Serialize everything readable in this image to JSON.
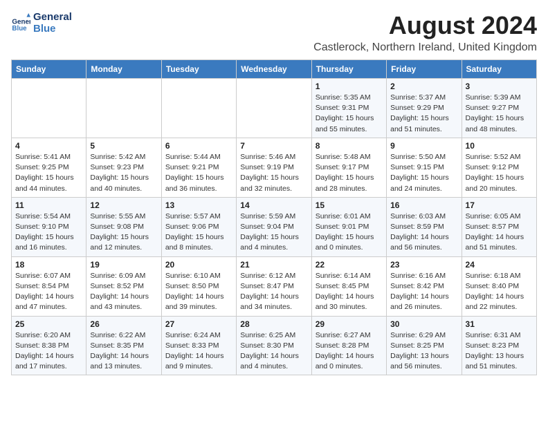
{
  "header": {
    "logo_line1": "General",
    "logo_line2": "Blue",
    "month_year": "August 2024",
    "location": "Castlerock, Northern Ireland, United Kingdom"
  },
  "weekdays": [
    "Sunday",
    "Monday",
    "Tuesday",
    "Wednesday",
    "Thursday",
    "Friday",
    "Saturday"
  ],
  "weeks": [
    [
      {
        "day": "",
        "detail": ""
      },
      {
        "day": "",
        "detail": ""
      },
      {
        "day": "",
        "detail": ""
      },
      {
        "day": "",
        "detail": ""
      },
      {
        "day": "1",
        "detail": "Sunrise: 5:35 AM\nSunset: 9:31 PM\nDaylight: 15 hours\nand 55 minutes."
      },
      {
        "day": "2",
        "detail": "Sunrise: 5:37 AM\nSunset: 9:29 PM\nDaylight: 15 hours\nand 51 minutes."
      },
      {
        "day": "3",
        "detail": "Sunrise: 5:39 AM\nSunset: 9:27 PM\nDaylight: 15 hours\nand 48 minutes."
      }
    ],
    [
      {
        "day": "4",
        "detail": "Sunrise: 5:41 AM\nSunset: 9:25 PM\nDaylight: 15 hours\nand 44 minutes."
      },
      {
        "day": "5",
        "detail": "Sunrise: 5:42 AM\nSunset: 9:23 PM\nDaylight: 15 hours\nand 40 minutes."
      },
      {
        "day": "6",
        "detail": "Sunrise: 5:44 AM\nSunset: 9:21 PM\nDaylight: 15 hours\nand 36 minutes."
      },
      {
        "day": "7",
        "detail": "Sunrise: 5:46 AM\nSunset: 9:19 PM\nDaylight: 15 hours\nand 32 minutes."
      },
      {
        "day": "8",
        "detail": "Sunrise: 5:48 AM\nSunset: 9:17 PM\nDaylight: 15 hours\nand 28 minutes."
      },
      {
        "day": "9",
        "detail": "Sunrise: 5:50 AM\nSunset: 9:15 PM\nDaylight: 15 hours\nand 24 minutes."
      },
      {
        "day": "10",
        "detail": "Sunrise: 5:52 AM\nSunset: 9:12 PM\nDaylight: 15 hours\nand 20 minutes."
      }
    ],
    [
      {
        "day": "11",
        "detail": "Sunrise: 5:54 AM\nSunset: 9:10 PM\nDaylight: 15 hours\nand 16 minutes."
      },
      {
        "day": "12",
        "detail": "Sunrise: 5:55 AM\nSunset: 9:08 PM\nDaylight: 15 hours\nand 12 minutes."
      },
      {
        "day": "13",
        "detail": "Sunrise: 5:57 AM\nSunset: 9:06 PM\nDaylight: 15 hours\nand 8 minutes."
      },
      {
        "day": "14",
        "detail": "Sunrise: 5:59 AM\nSunset: 9:04 PM\nDaylight: 15 hours\nand 4 minutes."
      },
      {
        "day": "15",
        "detail": "Sunrise: 6:01 AM\nSunset: 9:01 PM\nDaylight: 15 hours\nand 0 minutes."
      },
      {
        "day": "16",
        "detail": "Sunrise: 6:03 AM\nSunset: 8:59 PM\nDaylight: 14 hours\nand 56 minutes."
      },
      {
        "day": "17",
        "detail": "Sunrise: 6:05 AM\nSunset: 8:57 PM\nDaylight: 14 hours\nand 51 minutes."
      }
    ],
    [
      {
        "day": "18",
        "detail": "Sunrise: 6:07 AM\nSunset: 8:54 PM\nDaylight: 14 hours\nand 47 minutes."
      },
      {
        "day": "19",
        "detail": "Sunrise: 6:09 AM\nSunset: 8:52 PM\nDaylight: 14 hours\nand 43 minutes."
      },
      {
        "day": "20",
        "detail": "Sunrise: 6:10 AM\nSunset: 8:50 PM\nDaylight: 14 hours\nand 39 minutes."
      },
      {
        "day": "21",
        "detail": "Sunrise: 6:12 AM\nSunset: 8:47 PM\nDaylight: 14 hours\nand 34 minutes."
      },
      {
        "day": "22",
        "detail": "Sunrise: 6:14 AM\nSunset: 8:45 PM\nDaylight: 14 hours\nand 30 minutes."
      },
      {
        "day": "23",
        "detail": "Sunrise: 6:16 AM\nSunset: 8:42 PM\nDaylight: 14 hours\nand 26 minutes."
      },
      {
        "day": "24",
        "detail": "Sunrise: 6:18 AM\nSunset: 8:40 PM\nDaylight: 14 hours\nand 22 minutes."
      }
    ],
    [
      {
        "day": "25",
        "detail": "Sunrise: 6:20 AM\nSunset: 8:38 PM\nDaylight: 14 hours\nand 17 minutes."
      },
      {
        "day": "26",
        "detail": "Sunrise: 6:22 AM\nSunset: 8:35 PM\nDaylight: 14 hours\nand 13 minutes."
      },
      {
        "day": "27",
        "detail": "Sunrise: 6:24 AM\nSunset: 8:33 PM\nDaylight: 14 hours\nand 9 minutes."
      },
      {
        "day": "28",
        "detail": "Sunrise: 6:25 AM\nSunset: 8:30 PM\nDaylight: 14 hours\nand 4 minutes."
      },
      {
        "day": "29",
        "detail": "Sunrise: 6:27 AM\nSunset: 8:28 PM\nDaylight: 14 hours\nand 0 minutes."
      },
      {
        "day": "30",
        "detail": "Sunrise: 6:29 AM\nSunset: 8:25 PM\nDaylight: 13 hours\nand 56 minutes."
      },
      {
        "day": "31",
        "detail": "Sunrise: 6:31 AM\nSunset: 8:23 PM\nDaylight: 13 hours\nand 51 minutes."
      }
    ]
  ]
}
